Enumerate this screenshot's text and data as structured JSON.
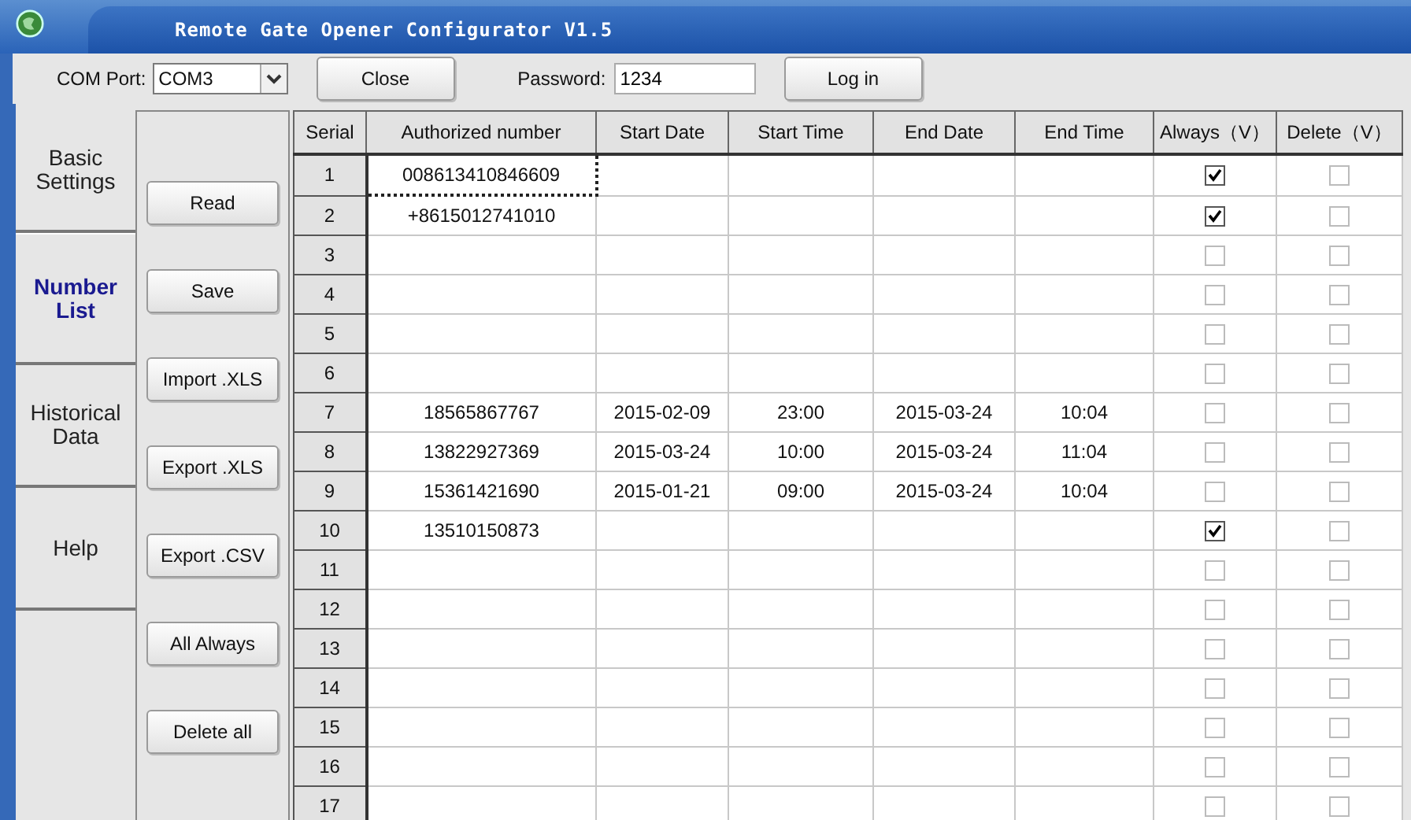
{
  "window": {
    "title": "Remote Gate Opener Configurator V1.5"
  },
  "toolbar": {
    "com_port_label": "COM Port:",
    "com_port_value": "COM3",
    "close_button": "Close",
    "password_label": "Password:",
    "password_value": "1234",
    "login_button": "Log in"
  },
  "tabs": [
    {
      "label": "Basic Settings",
      "selected": false
    },
    {
      "label": "Number List",
      "selected": true
    },
    {
      "label": "Historical Data",
      "selected": false
    },
    {
      "label": "Help",
      "selected": false
    }
  ],
  "actions": [
    "Read",
    "Save",
    "Import .XLS",
    "Export .XLS",
    "Export .CSV",
    "All Always",
    "Delete all"
  ],
  "table": {
    "columns": [
      "Serial",
      "Authorized number",
      "Start Date",
      "Start Time",
      "End Date",
      "End Time",
      "Always（V）",
      "Delete（V）"
    ],
    "rows": [
      {
        "serial": "1",
        "number": "008613410846609",
        "focused": true,
        "always": true,
        "delete": false
      },
      {
        "serial": "2",
        "number": "+8615012741010",
        "focused": false,
        "always": true,
        "delete": false
      },
      {
        "serial": "3",
        "focused": false,
        "always": false,
        "delete": false
      },
      {
        "serial": "4",
        "focused": false,
        "always": false,
        "delete": false
      },
      {
        "serial": "5",
        "focused": false,
        "always": false,
        "delete": false
      },
      {
        "serial": "6",
        "focused": false,
        "always": false,
        "delete": false
      },
      {
        "serial": "7",
        "number": "18565867767",
        "start_date": "2015-02-09",
        "start_time": "23:00",
        "end_date": "2015-03-24",
        "end_time": "10:04",
        "focused": false,
        "always": false,
        "delete": false
      },
      {
        "serial": "8",
        "number": "13822927369",
        "start_date": "2015-03-24",
        "start_time": "10:00",
        "end_date": "2015-03-24",
        "end_time": "11:04",
        "focused": false,
        "always": false,
        "delete": false
      },
      {
        "serial": "9",
        "number": "15361421690",
        "start_date": "2015-01-21",
        "start_time": "09:00",
        "end_date": "2015-03-24",
        "end_time": "10:04",
        "focused": false,
        "always": false,
        "delete": false
      },
      {
        "serial": "10",
        "number": "13510150873",
        "focused": false,
        "always": true,
        "delete": false
      },
      {
        "serial": "11",
        "focused": false,
        "always": false,
        "delete": false
      },
      {
        "serial": "12",
        "focused": false,
        "always": false,
        "delete": false
      },
      {
        "serial": "13",
        "focused": false,
        "always": false,
        "delete": false
      },
      {
        "serial": "14",
        "focused": false,
        "always": false,
        "delete": false
      },
      {
        "serial": "15",
        "focused": false,
        "always": false,
        "delete": false
      },
      {
        "serial": "16",
        "focused": false,
        "always": false,
        "delete": false
      },
      {
        "serial": "17",
        "focused": false,
        "always": false,
        "delete": false
      }
    ]
  }
}
